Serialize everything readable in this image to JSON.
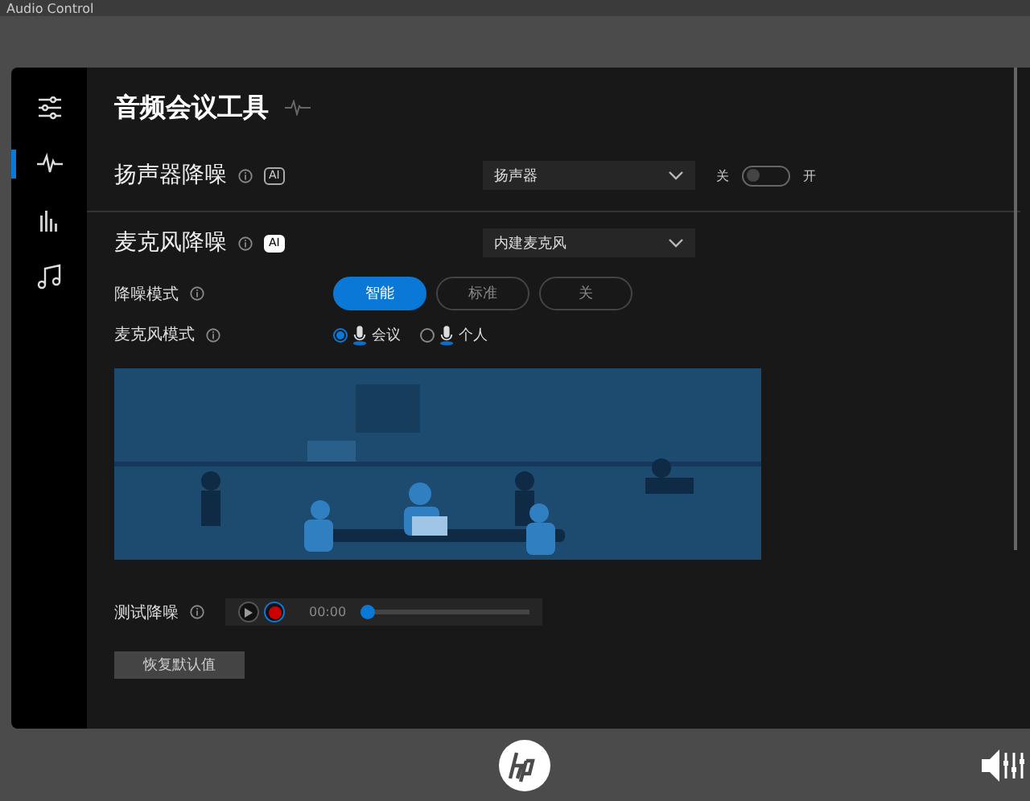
{
  "window": {
    "title": "Audio Control"
  },
  "sidebar": {
    "items": [
      {
        "kind": "sliders",
        "selected": false
      },
      {
        "kind": "wave",
        "selected": true
      },
      {
        "kind": "equalizer",
        "selected": false
      },
      {
        "kind": "music",
        "selected": false
      }
    ]
  },
  "page": {
    "title": "音频会议工具"
  },
  "speaker_noise_reduction": {
    "label": "扬声器降噪",
    "badge": "AI",
    "badge_active": false,
    "device": "扬声器",
    "toggle_off_label": "关",
    "toggle_on_label": "开",
    "on": false
  },
  "mic_noise_reduction": {
    "label": "麦克风降噪",
    "badge": "AI",
    "badge_active": true,
    "device": "内建麦克风",
    "mode_label": "降噪模式",
    "modes": [
      {
        "label": "智能",
        "selected": true
      },
      {
        "label": "标准",
        "selected": false
      },
      {
        "label": "关",
        "selected": false
      }
    ],
    "mic_mode_label": "麦克风模式",
    "mic_modes": [
      {
        "label": "会议",
        "selected": true
      },
      {
        "label": "个人",
        "selected": false
      }
    ]
  },
  "test": {
    "label": "测试降噪",
    "time": "00:00",
    "level": 0
  },
  "reset_button": "恢复默认值"
}
